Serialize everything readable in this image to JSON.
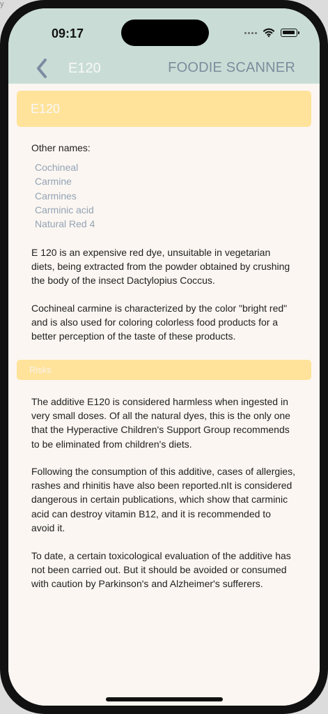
{
  "corner_text": "y",
  "status": {
    "time": "09:17"
  },
  "nav": {
    "title": "E120",
    "app_title": "FOODIE SCANNER"
  },
  "content": {
    "banner_title": "E120",
    "other_names_label": "Other names:",
    "other_names": [
      "Cochineal",
      "Carmine",
      "Carmines",
      "Carminic acid",
      "Natural Red 4"
    ],
    "description": [
      "E 120 is an expensive red dye, unsuitable in vegetarian diets, being extracted from the powder obtained by crushing the body of the insect Dactylopius Coccus.",
      "Cochineal carmine is characterized by the color \"bright red\" and is also used for coloring colorless food products for a better perception of the taste of these products."
    ],
    "risks_title": "Risks",
    "risks": [
      "The additive E120 is considered harmless when ingested in very small doses. Of all the natural dyes, this is the only one that the Hyperactive Children's Support Group recommends to be eliminated from children's diets.",
      "Following the consumption of this additive, cases of allergies, rashes and rhinitis have also been reported.nIt is considered dangerous in certain publications, which show that carminic acid can destroy vitamin B12, and it is recommended to avoid it.",
      "To date, a certain toxicological evaluation of the additive has not been carried out. But it should be avoided or consumed with caution by Parkinson's and Alzheimer's sufferers."
    ]
  },
  "colors": {
    "header_bg": "#c9ddd6",
    "banner_bg": "#ffe39b",
    "page_bg": "#fbf6f1",
    "name_text": "#93a3b5",
    "title_text": "#7d8c9c"
  },
  "icons": {
    "back": "chevron-left-icon",
    "wifi": "wifi-icon",
    "battery": "battery-icon",
    "signal": "signal-dots-icon"
  }
}
